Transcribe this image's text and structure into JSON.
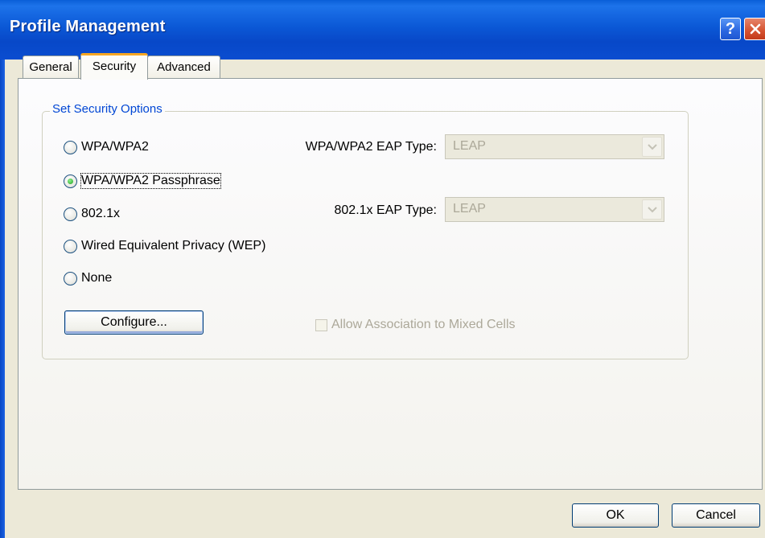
{
  "window": {
    "title": "Profile Management",
    "help_glyph": "?",
    "colors": {
      "titlebar": "#0a4dd0",
      "close_button": "#d5512f",
      "selected_tab_accent": "#f5a623",
      "groupbox_legend": "#0046d5"
    }
  },
  "tabs": [
    {
      "label": "General",
      "selected": false
    },
    {
      "label": "Security",
      "selected": true
    },
    {
      "label": "Advanced",
      "selected": false
    }
  ],
  "security": {
    "group_title": "Set Security Options",
    "options": [
      {
        "label": "WPA/WPA2",
        "selected": false
      },
      {
        "label": "WPA/WPA2 Passphrase",
        "selected": true
      },
      {
        "label": "802.1x",
        "selected": false
      },
      {
        "label": "Wired Equivalent Privacy (WEP)",
        "selected": false
      },
      {
        "label": "None",
        "selected": false
      }
    ],
    "wpa_eap_type": {
      "label": "WPA/WPA2 EAP Type:",
      "value": "LEAP",
      "enabled": false
    },
    "dot1x_eap_type": {
      "label": "802.1x EAP Type:",
      "value": "LEAP",
      "enabled": false
    },
    "configure_label": "Configure...",
    "mixed_cells": {
      "label": "Allow Association to Mixed Cells",
      "checked": false,
      "enabled": false
    }
  },
  "buttons": {
    "ok": "OK",
    "cancel": "Cancel"
  }
}
